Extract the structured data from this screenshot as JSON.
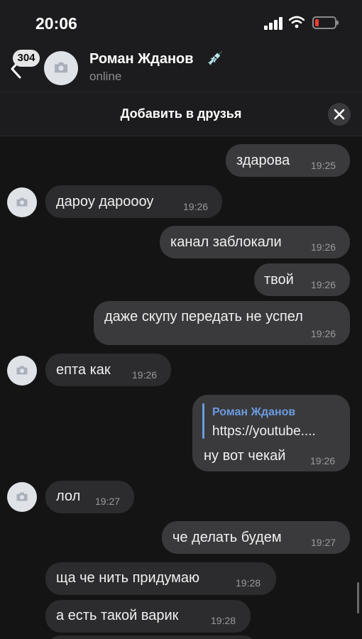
{
  "status_bar": {
    "time": "20:06"
  },
  "header": {
    "back_badge": "304",
    "contact_name": "Роман Жданов",
    "status": "online"
  },
  "friend_bar": {
    "label": "Добавить в друзья"
  },
  "messages": [
    {
      "dir": "out",
      "text": "здарова",
      "time": "19:25"
    },
    {
      "dir": "in",
      "text": "дароу дароооу",
      "time": "19:26"
    },
    {
      "dir": "out",
      "text": "канал заблокали",
      "time": "19:26"
    },
    {
      "dir": "out",
      "text": "твой",
      "time": "19:26"
    },
    {
      "dir": "out",
      "text": "даже скупу передать не успел",
      "time": "19:26"
    },
    {
      "dir": "in",
      "text": "епта как",
      "time": "19:26"
    },
    {
      "dir": "out",
      "reply_author": "Роман Жданов",
      "reply_text": "https://youtube....",
      "text": "ну вот чекай",
      "time": "19:26"
    },
    {
      "dir": "in",
      "text": "лол",
      "time": "19:27"
    },
    {
      "dir": "out",
      "text": "че делать будем",
      "time": "19:27"
    },
    {
      "dir": "in",
      "text": "ща че нить придумаю",
      "time": "19:28"
    },
    {
      "dir": "in",
      "text": "а есть такой варик",
      "time": "19:28"
    }
  ],
  "colors": {
    "background": "#141414",
    "bubble_in": "#2c2c2e",
    "bubble_out": "#3a3a3c",
    "accent": "#6b9be0",
    "battery_low": "#ff3b30"
  },
  "icons": [
    "back-arrow-icon",
    "camera-icon",
    "close-icon",
    "signal-icon",
    "wifi-icon",
    "battery-icon",
    "syringe-emoji-icon"
  ]
}
